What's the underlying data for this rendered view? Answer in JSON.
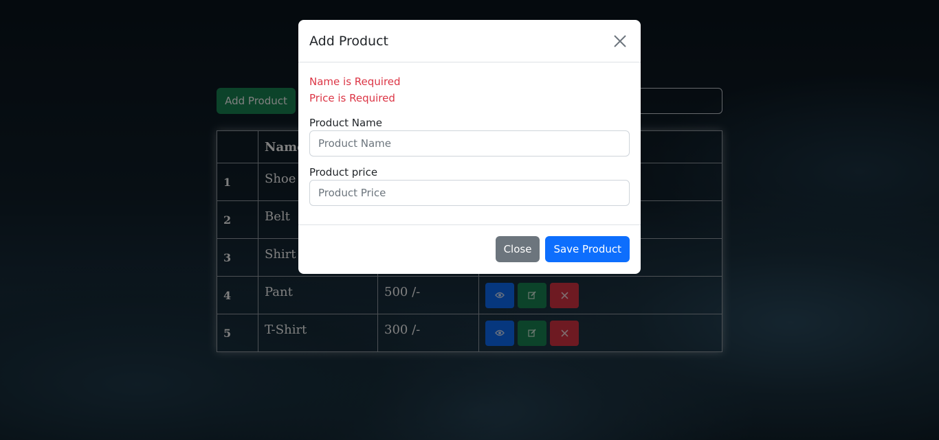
{
  "toolbar": {
    "add_label": "Add Product"
  },
  "table": {
    "headers": [
      "",
      "Name",
      "",
      ""
    ],
    "rows": [
      {
        "num": "1",
        "name": "Shoe",
        "price": ""
      },
      {
        "num": "2",
        "name": "Belt",
        "price": ""
      },
      {
        "num": "3",
        "name": "Shirt",
        "price": ""
      },
      {
        "num": "4",
        "name": "Pant",
        "price": "500 /-"
      },
      {
        "num": "5",
        "name": "T-Shirt",
        "price": "300 /-"
      }
    ]
  },
  "icons": {
    "view": "eye-icon",
    "edit": "edit-icon",
    "delete": "close-icon"
  },
  "colors": {
    "primary": "#0d6efd",
    "success": "#198754",
    "danger": "#dc3545",
    "secondary": "#6c757d"
  },
  "modal": {
    "title": "Add Product",
    "errors": {
      "name": "Name is Required",
      "price": "Price is Required"
    },
    "name_label": "Product Name",
    "name_placeholder": "Product Name",
    "name_value": "",
    "price_label": "Product price",
    "price_placeholder": "Product Price",
    "price_value": "",
    "close_label": "Close",
    "save_label": "Save Product"
  }
}
